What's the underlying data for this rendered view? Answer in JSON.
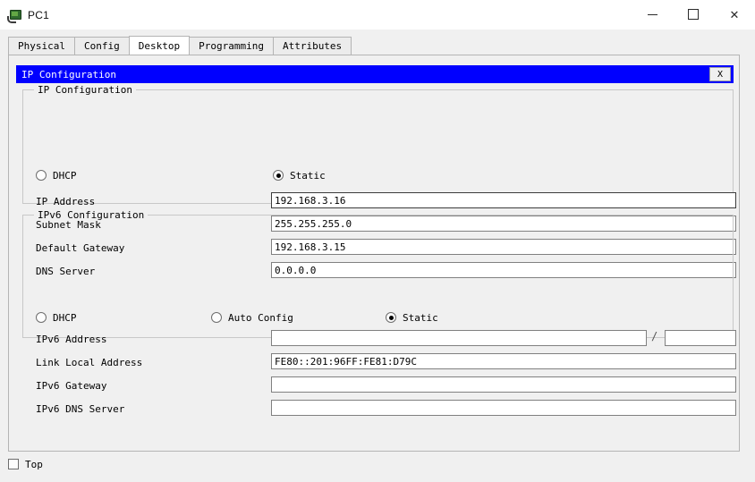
{
  "window": {
    "title": "PC1",
    "icon": "pc-device-icon",
    "controls": {
      "minimize": "—",
      "maximize": "☐",
      "close": "✕"
    }
  },
  "tabs": [
    {
      "label": "Physical",
      "active": false
    },
    {
      "label": "Config",
      "active": false
    },
    {
      "label": "Desktop",
      "active": true
    },
    {
      "label": "Programming",
      "active": false
    },
    {
      "label": "Attributes",
      "active": false
    }
  ],
  "panel": {
    "caption": "IP Configuration",
    "close_label": "X",
    "caption_bg": "#0000ff",
    "caption_fg": "#ffffff"
  },
  "ipv4": {
    "group_title": "IP Configuration",
    "mode_options": [
      {
        "label": "DHCP",
        "selected": false
      },
      {
        "label": "Static",
        "selected": true
      }
    ],
    "fields": [
      {
        "label": "IP Address",
        "value": "192.168.3.16",
        "focused": true
      },
      {
        "label": "Subnet Mask",
        "value": "255.255.255.0",
        "focused": false
      },
      {
        "label": "Default Gateway",
        "value": "192.168.3.15",
        "focused": false
      },
      {
        "label": "DNS Server",
        "value": "0.0.0.0",
        "focused": false
      }
    ]
  },
  "ipv6": {
    "group_title": "IPv6 Configuration",
    "mode_options": [
      {
        "label": "DHCP",
        "selected": false
      },
      {
        "label": "Auto Config",
        "selected": false
      },
      {
        "label": "Static",
        "selected": true
      }
    ],
    "address_label": "IPv6 Address",
    "address_value": "",
    "prefix_separator": "/",
    "prefix_value": "",
    "fields": [
      {
        "label": "Link Local Address",
        "value": "FE80::201:96FF:FE81:D79C"
      },
      {
        "label": "IPv6 Gateway",
        "value": ""
      },
      {
        "label": "IPv6 DNS Server",
        "value": ""
      }
    ]
  },
  "footer": {
    "top_checkbox_label": "Top",
    "top_checkbox_checked": false
  }
}
